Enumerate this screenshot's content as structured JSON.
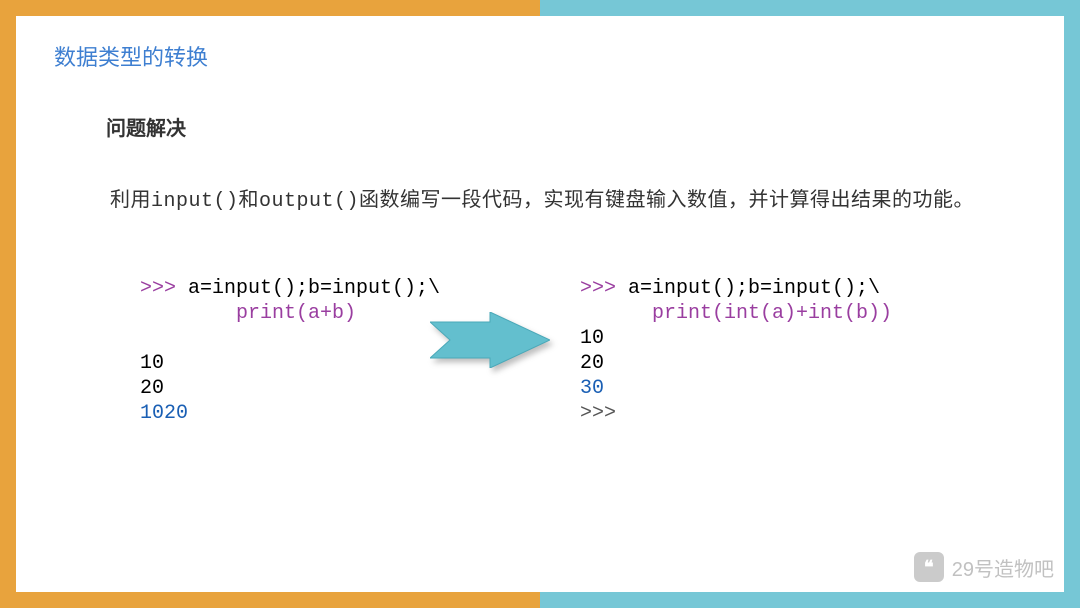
{
  "title": "数据类型的转换",
  "subtitle": "问题解决",
  "description": {
    "pre": "利用",
    "fn1": "input()",
    "mid1": "和",
    "fn2": "output()",
    "post": "函数编写一段代码，实现有键盘输入数值，并计算得出结果的功能。"
  },
  "left_code": {
    "l1_prompt": ">>> ",
    "l1_body": "a=input();b=input();\\",
    "l2_indent": "        ",
    "l2_body": "print(a+b)",
    "blank": "",
    "in1": "10",
    "in2": "20",
    "out": "1020"
  },
  "right_code": {
    "l1_prompt": ">>> ",
    "l1_body": "a=input();b=input();\\",
    "l2_indent": "      ",
    "l2_body": "print(int(a)+int(b))",
    "in1": "10",
    "in2": "20",
    "out": "30",
    "tail": ">>>"
  },
  "watermark": "29号造物吧",
  "colors": {
    "orange": "#e8a33d",
    "blue": "#76c7d6",
    "arrow": "#63bfce"
  }
}
